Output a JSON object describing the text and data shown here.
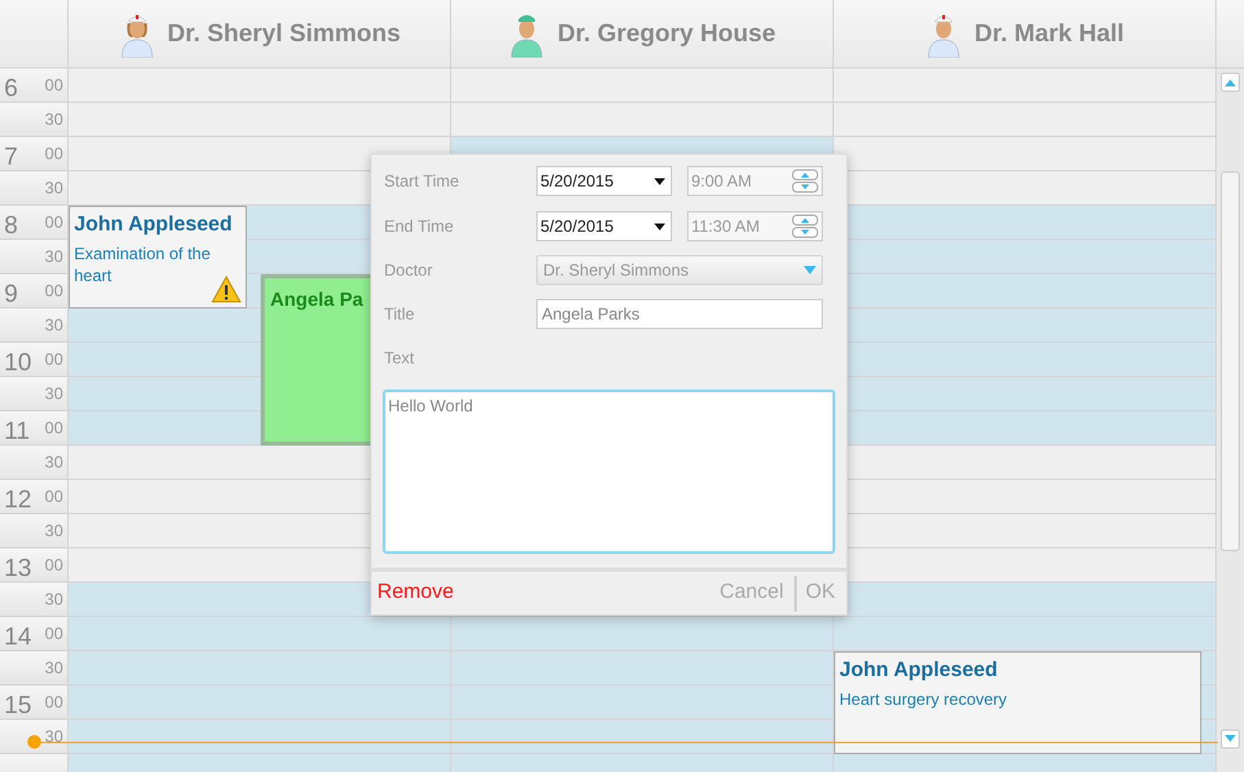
{
  "doctors": [
    {
      "name": "Dr. Sheryl Simmons",
      "slots": [
        {
          "working": false
        },
        {
          "working": false
        },
        {
          "working": false
        },
        {
          "working": false
        },
        {
          "working": true,
          "appointment": {
            "kind": "normal",
            "title": "John Appleseed",
            "text": "Examination of the heart",
            "warning": true
          }
        },
        {
          "working": true
        },
        {
          "working": true,
          "appointment_ends": true,
          "appointment": {
            "kind": "editing",
            "title": "Angela Pa"
          }
        },
        {
          "working": true
        },
        {
          "working": true
        },
        {
          "working": true
        },
        {
          "working": true,
          "appointment_ends": true
        },
        {
          "working": false
        },
        {
          "working": false
        },
        {
          "working": false
        },
        {
          "working": false
        },
        {
          "working": true
        },
        {
          "working": true
        },
        {
          "working": true
        },
        {
          "working": true
        },
        {
          "working": true
        },
        {
          "working": true
        }
      ]
    },
    {
      "name": "Dr. Gregory House",
      "slots": [
        {
          "working": false
        },
        {
          "working": false
        },
        {
          "working": true
        }
      ],
      "slots_below_dialog": [
        {
          "working": true
        },
        {
          "working": true
        },
        {
          "working": true
        },
        {
          "working": true
        },
        {
          "working": true
        }
      ]
    },
    {
      "name": "Dr. Mark Hall",
      "slots": [
        {
          "working": false
        },
        {
          "working": false
        },
        {
          "working": false
        },
        {
          "working": false
        },
        {
          "working": true
        },
        {
          "working": true
        },
        {
          "working": true
        },
        {
          "working": true
        },
        {
          "working": true
        },
        {
          "working": true
        },
        {
          "working": true
        },
        {
          "working": false
        },
        {
          "working": false
        },
        {
          "working": false
        },
        {
          "working": false
        },
        {
          "working": true
        },
        {
          "working": true
        },
        {
          "working": true,
          "appointment": {
            "kind": "normal",
            "title": "John Appleseed",
            "text": "Heart surgery recovery"
          }
        },
        {
          "working": true
        },
        {
          "working": true,
          "appointment_ends": true
        },
        {
          "working": true
        }
      ]
    }
  ],
  "time_slots": [
    {
      "hour": "6",
      "minute": "00"
    },
    {
      "minute": "30"
    },
    {
      "hour": "7",
      "minute": "00"
    },
    {
      "minute": "30"
    },
    {
      "hour": "8",
      "minute": "00"
    },
    {
      "minute": "30"
    },
    {
      "hour": "9",
      "minute": "00"
    },
    {
      "minute": "30"
    },
    {
      "hour": "10",
      "minute": "00"
    },
    {
      "minute": "30"
    },
    {
      "hour": "11",
      "minute": "00"
    },
    {
      "minute": "30"
    },
    {
      "hour": "12",
      "minute": "00"
    },
    {
      "minute": "30"
    },
    {
      "hour": "13",
      "minute": "00"
    },
    {
      "minute": "30"
    },
    {
      "hour": "14",
      "minute": "00"
    },
    {
      "minute": "30"
    },
    {
      "hour": "15",
      "minute": "00"
    },
    {
      "minute": "30"
    }
  ],
  "dialog": {
    "start_label": "Start Time",
    "start_date": "5/20/2015",
    "start_time": "9:00 AM",
    "end_label": "End Time",
    "end_date": "5/20/2015",
    "end_time": "11:30 AM",
    "doctor_label": "Doctor",
    "doctor": "Dr. Sheryl Simmons",
    "title_label": "Title",
    "title": "Angela Parks",
    "text_label": "Text",
    "text": "Hello World",
    "remove": "Remove",
    "cancel": "Cancel",
    "ok": "OK"
  }
}
